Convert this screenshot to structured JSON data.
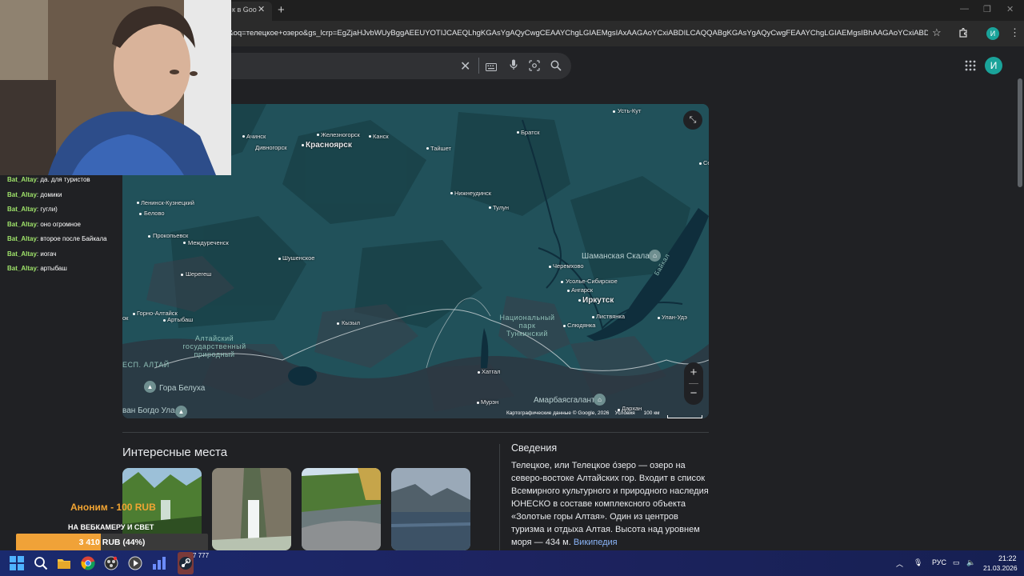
{
  "browser": {
    "tab_title": "к в Goo",
    "url": "o&oq=телецкое+озеро&gs_lcrp=EgZjaHJvbWUyBggAEEUYOTIJCAEQLhgKGAsYgAQyCwgCEAAYChgLGIAEMgsIAxAAGAoYCxiABDILCAQQABgKGAsYgAQyCwgFEAAYChgLGIAEMgsIBhAAGAoYCxiABDILCAcQABg...",
    "profile_initial": "И"
  },
  "google": {
    "avatar_initial": "И"
  },
  "map": {
    "cities": [
      {
        "name": "Усть-Кут",
        "big": false
      },
      {
        "name": "Братск",
        "big": false
      },
      {
        "name": "Ачинск",
        "big": false
      },
      {
        "name": "Железногорск",
        "big": false
      },
      {
        "name": "Канск",
        "big": false
      },
      {
        "name": "Дивногорск",
        "big": false
      },
      {
        "name": "Красноярск",
        "big": true
      },
      {
        "name": "Тайшет",
        "big": false
      },
      {
        "name": "Нижнеудинск",
        "big": false
      },
      {
        "name": "Ленинск-Кузнецкий",
        "big": false
      },
      {
        "name": "Белово",
        "big": false
      },
      {
        "name": "Тулун",
        "big": false
      },
      {
        "name": "Прокопьевск",
        "big": false
      },
      {
        "name": "Междуреченск",
        "big": false
      },
      {
        "name": "Шушенское",
        "big": false
      },
      {
        "name": "Черемхово",
        "big": false
      },
      {
        "name": "Шерегеш",
        "big": false
      },
      {
        "name": "Усолье-Сибирское",
        "big": false
      },
      {
        "name": "Ангарск",
        "big": false
      },
      {
        "name": "Иркутск",
        "big": true
      },
      {
        "name": "Горно-Алтайск",
        "big": false
      },
      {
        "name": "Листвянка",
        "big": false
      },
      {
        "name": "Улан-Удэ",
        "big": false
      },
      {
        "name": "Артыбаш",
        "big": false
      },
      {
        "name": "Кызыл",
        "big": false
      },
      {
        "name": "Слюдянка",
        "big": false
      },
      {
        "name": "Хатгал",
        "big": false
      },
      {
        "name": "Мурэн",
        "big": false
      },
      {
        "name": "Дархан",
        "big": false
      },
      {
        "name": "Се",
        "big": false
      },
      {
        "name": "ок",
        "big": false
      }
    ],
    "regions": [
      {
        "name": "Алтайский государственный природный"
      },
      {
        "name": "ЕСП. АЛТАЙ"
      },
      {
        "name": "Национальный парк Тункинский"
      }
    ],
    "pois": [
      "Шаманская Скала",
      "Гора Белуха",
      "Амарбаясгалант",
      "ван Богдо Ула"
    ],
    "water_label": "Байкал",
    "attribution": "Картографические данные © Google, 2026",
    "terms": "Условия",
    "scale": "100 км",
    "zoom_in": "+",
    "zoom_out": "−"
  },
  "places": {
    "title": "Интересные места"
  },
  "about": {
    "title": "Сведения",
    "text": "Телецкое, или Телецкое о́зеро — озеро на северо-востоке Алтайских гор. Входит в список Всемирного культурного и природного наследия ЮНЕСКО в составе комплексного объекта «Золотые горы Алтая». Один из центров туризма и отдыха Алтая. Высота над уровнем моря — 434 м.",
    "link": "Википедия"
  },
  "chat": [
    {
      "user": "Bat_Altay",
      "msg": "да. для туристов"
    },
    {
      "user": "Bat_Altay",
      "msg": "домики"
    },
    {
      "user": "Bat_Altay",
      "msg": "гугли)"
    },
    {
      "user": "Bat_Altay",
      "msg": "оно огромное"
    },
    {
      "user": "Bat_Altay",
      "msg": "второе после Байкала"
    },
    {
      "user": "Bat_Altay",
      "msg": "иогач"
    },
    {
      "user": "Bat_Altay",
      "msg": "артыбаш"
    }
  ],
  "donation": {
    "name": "Аноним - 100 RUB",
    "message": "НА ВЕБКАМЕРУ И СВЕТ",
    "goal_text": "3 410 RUB (44%)",
    "goal_percent": 44,
    "fill_color": "#f0a238"
  },
  "taskbar": {
    "badge": "7 777",
    "lang": "РУС",
    "time": "21:22",
    "date": "21.03.2026"
  }
}
